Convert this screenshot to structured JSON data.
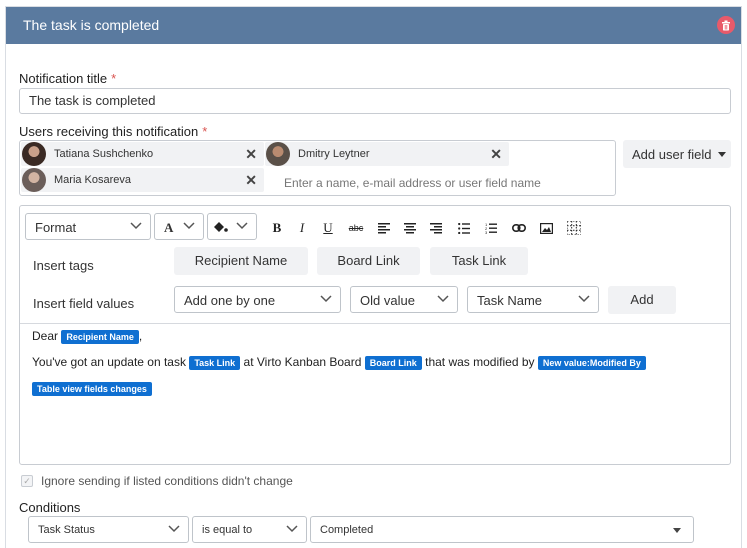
{
  "header": {
    "title": "The task is completed",
    "delete_icon": "trash-icon"
  },
  "form": {
    "notification_title_label": "Notification title",
    "notification_title_value": "The task is completed",
    "users_label": "Users receiving this notification",
    "required_mark": "*",
    "users": [
      {
        "name": "Tatiana Sushchenko"
      },
      {
        "name": "Dmitry Leytner"
      },
      {
        "name": "Maria Kosareva"
      }
    ],
    "users_placeholder": "Enter a name, e-mail address or user field name",
    "add_user_field_label": "Add user field"
  },
  "editor": {
    "format_select": "Format",
    "font_color_label": "A",
    "toolbar": {
      "bold": "B",
      "italic": "I",
      "underline": "U",
      "strikethrough": "abc"
    },
    "insert_tags_label": "Insert tags",
    "tags": [
      "Recipient Name",
      "Board Link",
      "Task Link"
    ],
    "insert_field_values_label": "Insert field values",
    "field_values": {
      "mode": "Add one by one",
      "value_type": "Old value",
      "field": "Task Name",
      "add_label": "Add"
    },
    "content": {
      "line1_prefix": "Dear",
      "line1_tag": "Recipient Name",
      "line1_suffix": ",",
      "line2_text1": "You've got an update on task",
      "line2_tag1": "Task Link",
      "line2_text2": "at Virto Kanban Board",
      "line2_tag2": "Board Link",
      "line2_text3": "that was modified by",
      "line2_tag3": "New value:Modified By",
      "line3_tag": "Table view fields changes"
    }
  },
  "ignore_checkbox": {
    "label": "Ignore sending if listed conditions didn't change",
    "checked": true
  },
  "conditions": {
    "label": "Conditions",
    "field": "Task Status",
    "operator": "is equal to",
    "value": "Completed"
  },
  "colors": {
    "header": "#5a7a9f",
    "accent": "#0f6fd1",
    "delete": "#e85a6a"
  }
}
